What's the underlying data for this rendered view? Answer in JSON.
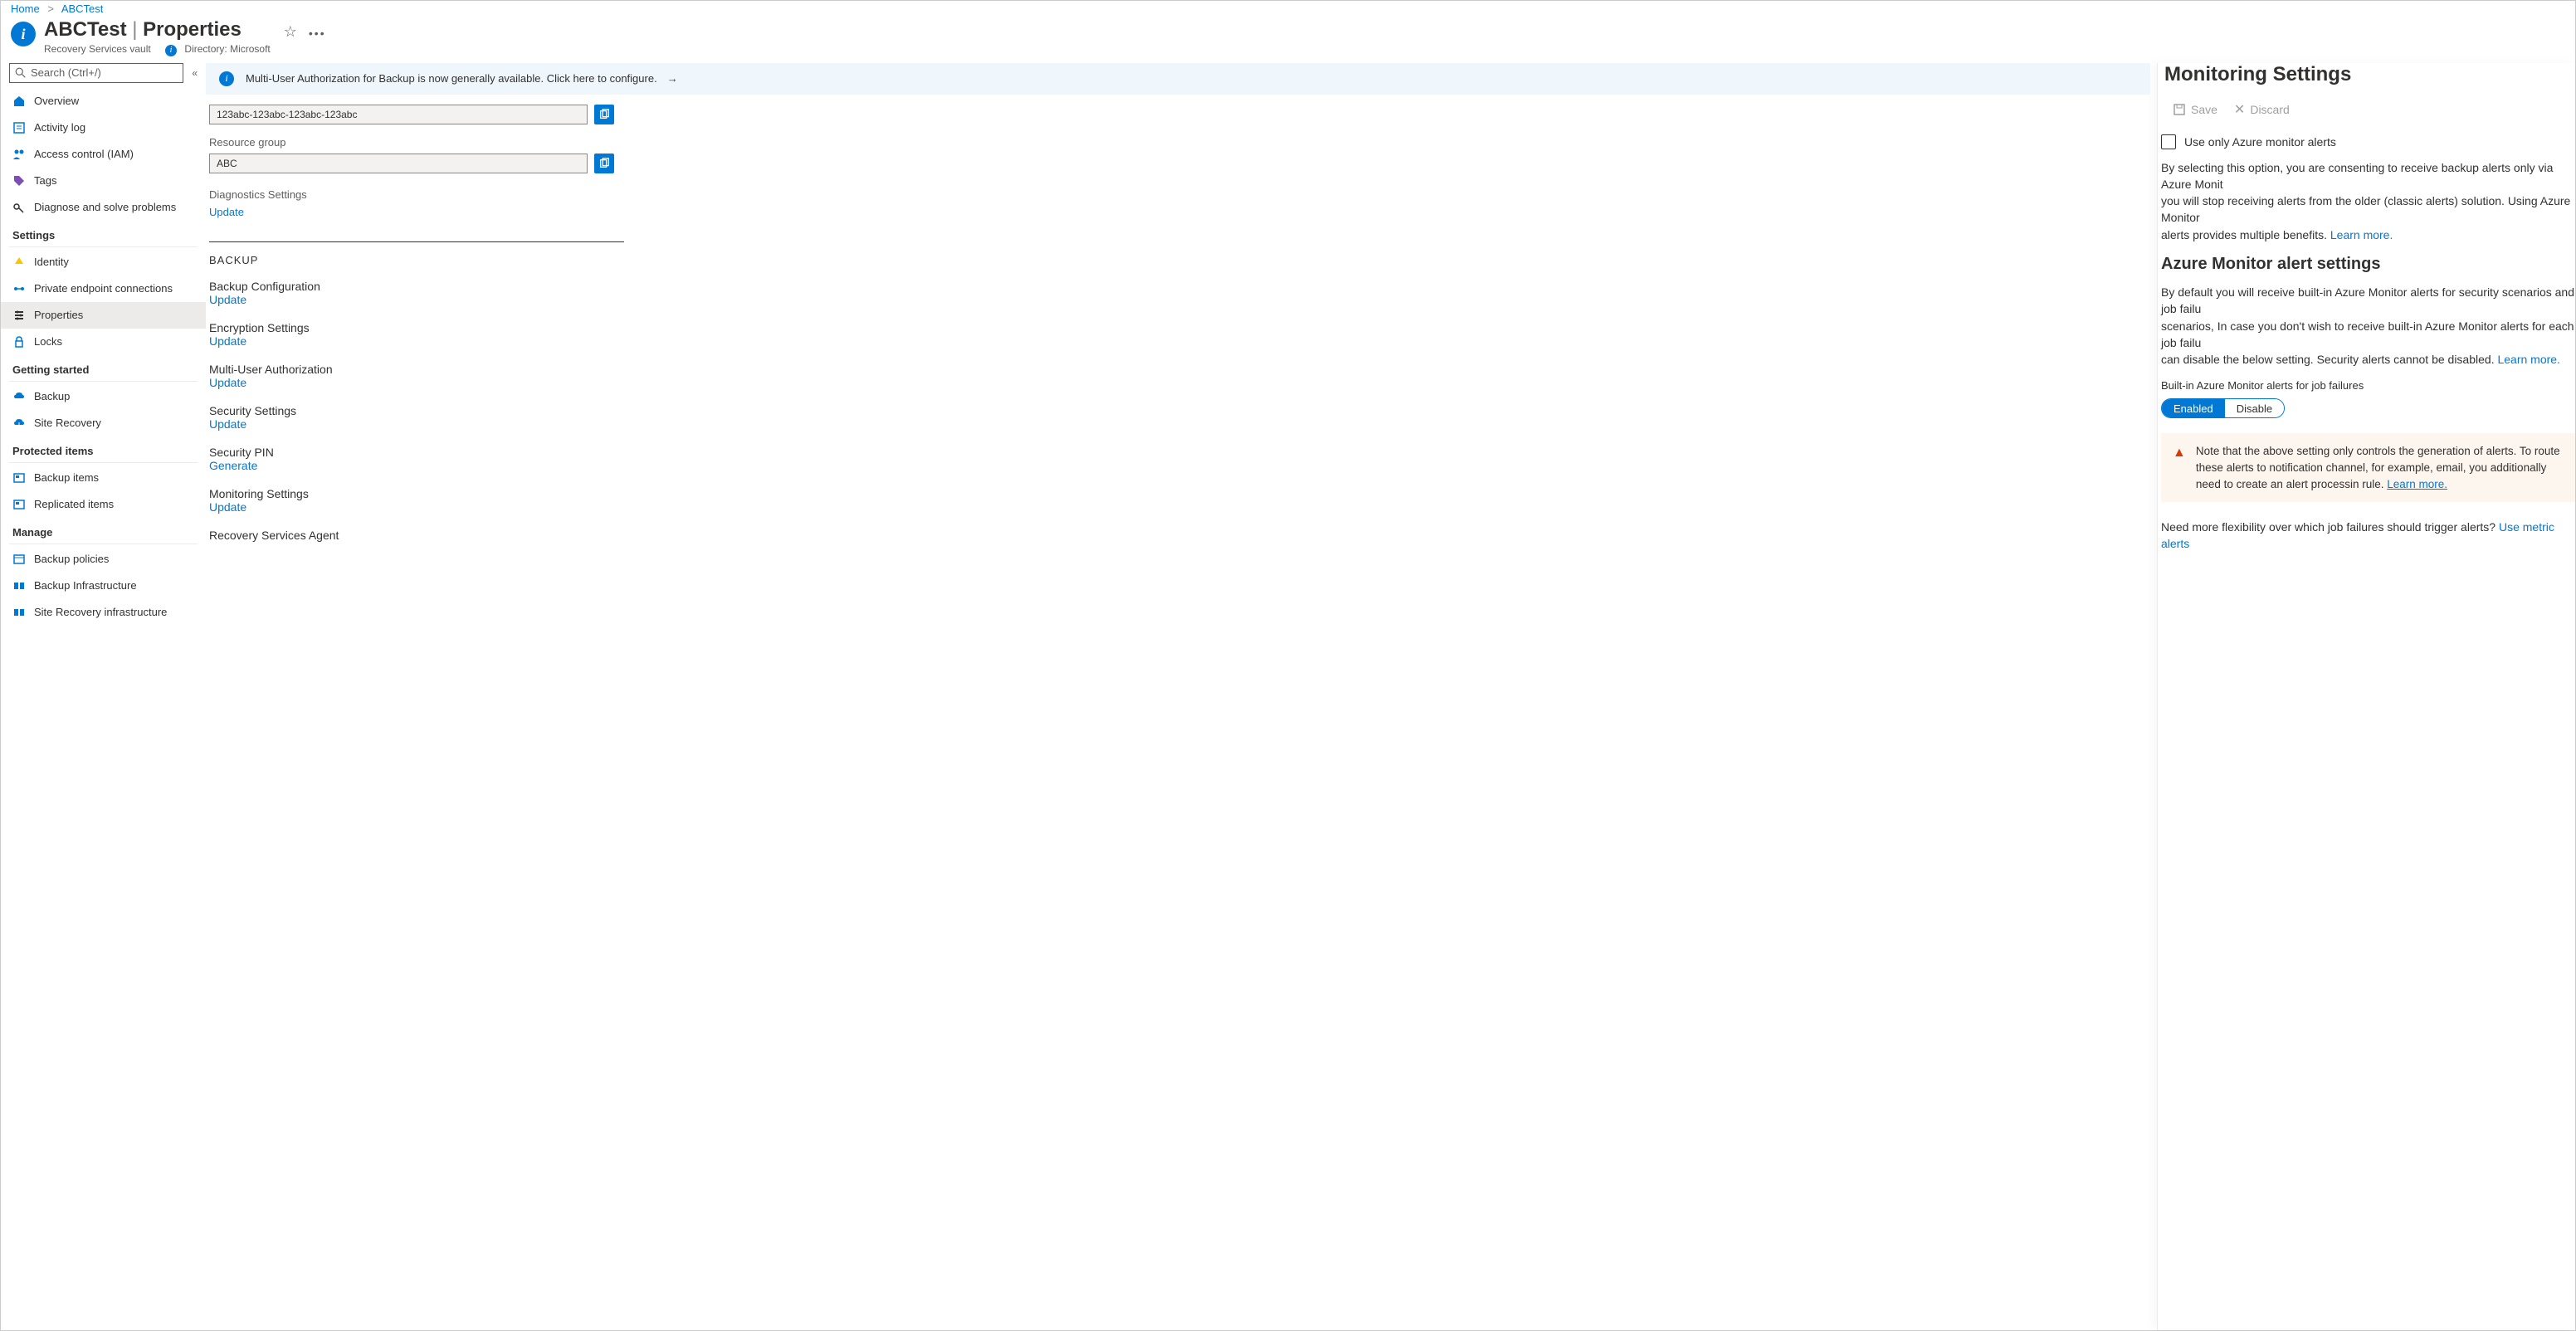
{
  "breadcrumb": {
    "home": "Home",
    "current": "ABCTest"
  },
  "header": {
    "title_name": "ABCTest",
    "title_sep": " | ",
    "title_page": "Properties",
    "subtitle_type": "Recovery Services vault",
    "subtitle_dir": "Directory: Microsoft"
  },
  "search": {
    "placeholder": "Search (Ctrl+/)"
  },
  "nav": {
    "top": [
      {
        "label": "Overview"
      },
      {
        "label": "Activity log"
      },
      {
        "label": "Access control (IAM)"
      },
      {
        "label": "Tags"
      },
      {
        "label": "Diagnose and solve problems"
      }
    ],
    "settings_header": "Settings",
    "settings": [
      {
        "label": "Identity"
      },
      {
        "label": "Private endpoint connections"
      },
      {
        "label": "Properties",
        "active": true
      },
      {
        "label": "Locks"
      }
    ],
    "getting_started_header": "Getting started",
    "getting_started": [
      {
        "label": "Backup"
      },
      {
        "label": "Site Recovery"
      }
    ],
    "protected_header": "Protected items",
    "protected": [
      {
        "label": "Backup items"
      },
      {
        "label": "Replicated items"
      }
    ],
    "manage_header": "Manage",
    "manage": [
      {
        "label": "Backup policies"
      },
      {
        "label": "Backup Infrastructure"
      },
      {
        "label": "Site Recovery infrastructure"
      }
    ]
  },
  "banner": {
    "text": "Multi-User Authorization for Backup is now generally available. Click here to configure."
  },
  "content": {
    "id_value": "123abc-123abc-123abc-123abc",
    "rg_label": "Resource group",
    "rg_value": "ABC",
    "diag_label": "Diagnostics Settings",
    "update": "Update",
    "backup_header": "BACKUP",
    "items": [
      {
        "title": "Backup Configuration",
        "action": "Update"
      },
      {
        "title": "Encryption Settings",
        "action": "Update"
      },
      {
        "title": "Multi-User Authorization",
        "action": "Update"
      },
      {
        "title": "Security Settings",
        "action": "Update"
      },
      {
        "title": "Security PIN",
        "action": "Generate"
      },
      {
        "title": "Monitoring Settings",
        "action": "Update"
      },
      {
        "title": "Recovery Services Agent",
        "action": ""
      }
    ]
  },
  "panel": {
    "title": "Monitoring Settings",
    "save": "Save",
    "discard": "Discard",
    "chk_label": "Use only Azure monitor alerts",
    "p1a": "By selecting this option, you are consenting to receive backup alerts only via Azure Monit",
    "p1b": "you will stop receiving alerts from the older (classic alerts) solution. Using Azure Monitor ",
    "p1c": "alerts provides multiple benefits. ",
    "learn_more": "Learn more.",
    "h3": "Azure Monitor alert settings",
    "p2a": "By default you will receive built-in Azure Monitor alerts for security scenarios and job failu",
    "p2b": "scenarios, In case you don't wish to receive built-in Azure Monitor alerts for each job failu",
    "p2c": "can disable the below setting. Security alerts cannot be disabled. ",
    "toggle_label": "Built-in Azure Monitor alerts for job failures",
    "toggle_on": "Enabled",
    "toggle_off": "Disable",
    "warn": "Note that the above setting only controls the generation of alerts. To route these alerts to notification channel, for example, email, you additionally need to create an alert processin rule. ",
    "warn_link": "Learn more.",
    "foot": "Need more flexibility over which job failures should trigger alerts? ",
    "foot_link": "Use metric alerts"
  }
}
